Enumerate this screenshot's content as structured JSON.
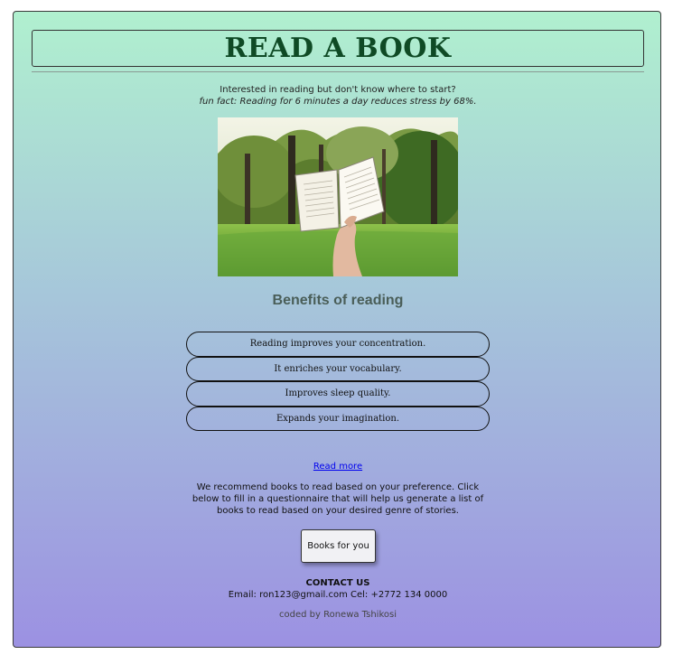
{
  "header": {
    "title": "READ A BOOK"
  },
  "intro": {
    "line1": "Interested in reading but don't know where to start?",
    "fun_fact": "fun fact: Reading for 6 minutes a day reduces stress by 68%."
  },
  "photo": {
    "alt": "book in the park",
    "icon": "hand-holding-open-book-image"
  },
  "benefits": {
    "title": "Benefits of reading",
    "items": [
      "Reading improves your concentration.",
      "It enriches your vocabulary.",
      "Improves sleep quality.",
      "Expands your imagination."
    ]
  },
  "read_more": {
    "label": "Read more"
  },
  "recommend": {
    "text": "We recommend books to read based on your preference. Click below to fill in a questionnaire that will help us generate a list of books to read based on your desired genre of stories."
  },
  "cta": {
    "label": "Books for you"
  },
  "contact": {
    "heading": "CONTACT US",
    "details": "Email: ron123@gmail.com Cel: +2772 134 0000"
  },
  "footer": {
    "credit": "coded by Ronewa Tshikosi"
  },
  "colors": {
    "gradient_top": "#b0f0cf",
    "gradient_mid": "#a6c6da",
    "gradient_bottom": "#9c91e2",
    "title_green": "#0f4a25",
    "link_blue": "#0000ee"
  }
}
